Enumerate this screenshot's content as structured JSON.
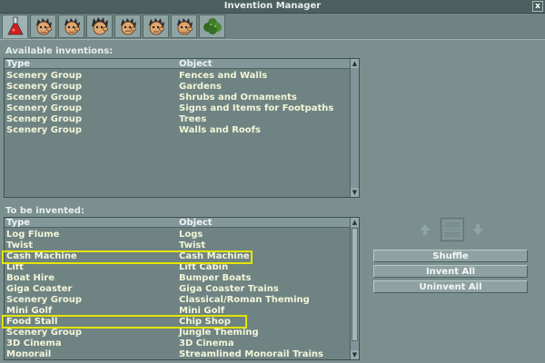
{
  "window": {
    "title": "Invention Manager",
    "close_label": "x"
  },
  "tabs": [
    {
      "name": "tab-research-flask",
      "icon": "flask-icon"
    },
    {
      "name": "tab-face-1",
      "icon": "face-icon"
    },
    {
      "name": "tab-face-2",
      "icon": "face-icon"
    },
    {
      "name": "tab-face-3",
      "icon": "face-icon"
    },
    {
      "name": "tab-face-4",
      "icon": "face-icon"
    },
    {
      "name": "tab-face-5",
      "icon": "face-icon"
    },
    {
      "name": "tab-face-6",
      "icon": "face-icon"
    },
    {
      "name": "tab-scenery",
      "icon": "scenery-icon"
    }
  ],
  "available": {
    "label": "Available inventions:",
    "columns": [
      "Type",
      "Object"
    ],
    "rows": [
      [
        "Scenery Group",
        "Fences and Walls"
      ],
      [
        "Scenery Group",
        "Gardens"
      ],
      [
        "Scenery Group",
        "Shrubs and Ornaments"
      ],
      [
        "Scenery Group",
        "Signs and Items for Footpaths"
      ],
      [
        "Scenery Group",
        "Trees"
      ],
      [
        "Scenery Group",
        "Walls and Roofs"
      ]
    ]
  },
  "to_invent": {
    "label": "To be invented:",
    "columns": [
      "Type",
      "Object"
    ],
    "rows": [
      [
        "Log Flume",
        "Logs"
      ],
      [
        "Twist",
        "Twist"
      ],
      [
        "Cash Machine",
        "Cash Machine"
      ],
      [
        "Lift",
        "Lift Cabin"
      ],
      [
        "Boat Hire",
        "Bumper Boats"
      ],
      [
        "Giga Coaster",
        "Giga Coaster Trains"
      ],
      [
        "Scenery Group",
        "Classical/Roman Theming"
      ],
      [
        "Mini Golf",
        "Mini Golf"
      ],
      [
        "Food Stall",
        "Chip Shop"
      ],
      [
        "Scenery Group",
        "Jungle Theming"
      ],
      [
        "3D Cinema",
        "3D Cinema"
      ],
      [
        "Monorail",
        "Streamlined Monorail Trains"
      ]
    ]
  },
  "buttons": {
    "shuffle": "Shuffle",
    "invent_all": "Invent All",
    "uninvent_all": "Uninvent All"
  },
  "colors": {
    "highlight": "#e4e400",
    "row_text": "#f2f5d8"
  }
}
